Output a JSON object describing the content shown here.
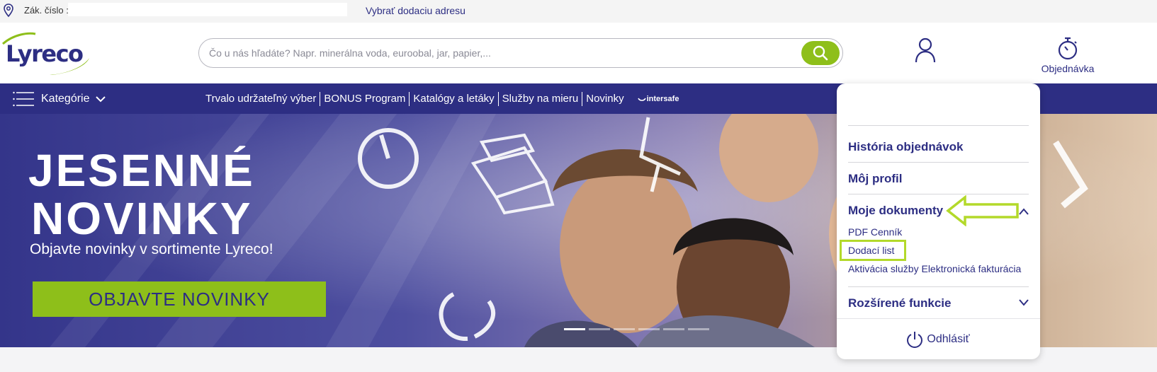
{
  "topbar": {
    "customer_label": "Zák. číslo :",
    "customer_value": "",
    "delivery_address_link": "Vybrať dodaciu adresu"
  },
  "header": {
    "logo_text": "Lyreco",
    "search_placeholder": "Čo u nás hľadáte? Napr. minerálna voda, euroobal, jar, papier,...",
    "order_label": "Objednávka"
  },
  "nav": {
    "categories_label": "Kategórie",
    "links": [
      "Trvalo udržateľný výber",
      "BONUS Program",
      "Katalógy a letáky",
      "Služby na mieru",
      "Novinky"
    ],
    "intersafe_label": "intersafe"
  },
  "banner": {
    "title_line1": "JESENNÉ",
    "title_line2": "NOVINKY",
    "subtitle": "Objavte novinky v sortimente Lyreco!",
    "cta_label": "OBJAVTE NOVINKY"
  },
  "account_menu": {
    "items": {
      "history": "História objednávok",
      "profile": "Môj profil",
      "documents": "Moje dokumenty",
      "advanced": "Rozšírené funkcie"
    },
    "documents_submenu": [
      "PDF Cenník",
      "Dodací list",
      "Aktivácia služby Elektronická fakturácia"
    ],
    "logout_label": "Odhlásiť"
  },
  "colors": {
    "brand_blue": "#2d2e83",
    "brand_green": "#8ebf1a",
    "highlight_green": "#b3d92a"
  }
}
